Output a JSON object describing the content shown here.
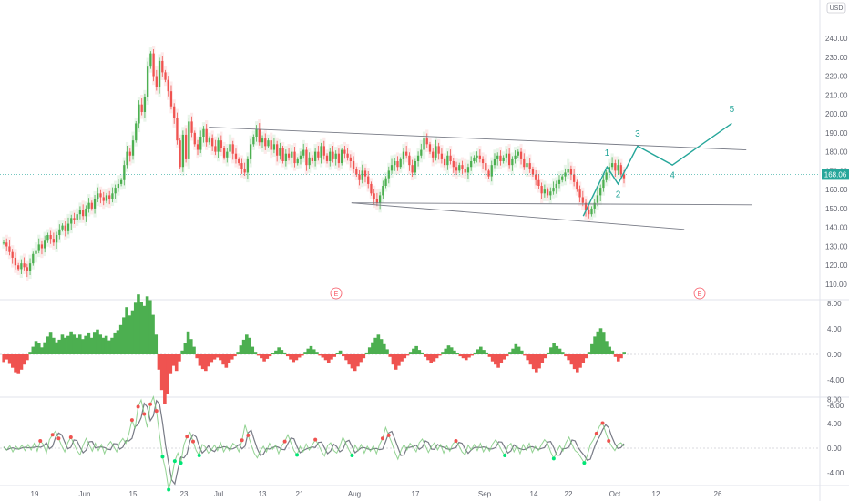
{
  "chart_data": {
    "type": "candlestick",
    "currency": "USD",
    "price_label": "168.06",
    "price_axis": {
      "min": 110,
      "max": 240,
      "ticks": [
        "240.00",
        "230.00",
        "220.00",
        "210.00",
        "200.00",
        "190.00",
        "180.00",
        "170.00",
        "160.00",
        "150.00",
        "140.00",
        "130.00",
        "120.00",
        "110.00"
      ]
    },
    "time_axis": {
      "ticks": [
        "19",
        "Jun",
        "15",
        "23",
        "Jul",
        "13",
        "21",
        "Aug",
        "17",
        "Sep",
        "14",
        "22",
        "Oct",
        "12",
        "26"
      ]
    },
    "osc1_axis": {
      "ticks": [
        "8.00",
        "4.00",
        "0.00",
        "-4.00",
        "-8.00"
      ]
    },
    "osc2_axis": {
      "ticks": [
        "8.00",
        "4.00",
        "0.00",
        "-4.00"
      ]
    },
    "earnings_marker": "E",
    "closes": [
      132,
      130,
      127,
      124,
      120,
      118,
      121,
      119,
      117,
      121,
      126,
      128,
      131,
      129,
      133,
      136,
      134,
      132,
      136,
      139,
      141,
      138,
      142,
      145,
      144,
      147,
      149,
      146,
      150,
      153,
      150,
      155,
      158,
      156,
      154,
      157,
      155,
      158,
      161,
      163,
      165,
      173,
      180,
      178,
      186,
      195,
      205,
      201,
      209,
      225,
      232,
      220,
      214,
      228,
      222,
      218,
      212,
      204,
      198,
      186,
      172,
      189,
      176,
      196,
      190,
      184,
      181,
      188,
      192,
      185,
      187,
      183,
      180,
      186,
      182,
      177,
      180,
      184,
      179,
      176,
      174,
      171,
      169,
      176,
      184,
      188,
      192,
      185,
      187,
      183,
      186,
      181,
      184,
      178,
      182,
      175,
      179,
      177,
      180,
      174,
      176,
      178,
      181,
      173,
      177,
      175,
      180,
      177,
      183,
      178,
      175,
      180,
      176,
      179,
      174,
      181,
      179,
      177,
      175,
      171,
      168,
      165,
      170,
      167,
      163,
      158,
      155,
      153,
      157,
      162,
      166,
      170,
      173,
      175,
      172,
      176,
      180,
      178,
      173,
      169,
      175,
      178,
      181,
      187,
      184,
      180,
      177,
      183,
      179,
      176,
      173,
      178,
      175,
      172,
      170,
      173,
      171,
      169,
      172,
      175,
      177,
      178,
      176,
      174,
      170,
      167,
      173,
      176,
      178,
      175,
      177,
      179,
      173,
      176,
      178,
      180,
      176,
      172,
      174,
      171,
      168,
      165,
      162,
      158,
      160,
      157,
      159,
      161,
      163,
      165,
      167,
      169,
      171,
      168,
      164,
      160,
      156,
      153,
      149,
      147,
      150,
      153,
      157,
      161,
      165,
      169,
      172,
      174,
      170,
      173,
      168,
      166
    ],
    "osc1_values": [
      -1.2,
      -0.8,
      -1.5,
      -2.1,
      -2.8,
      -3.1,
      -2.4,
      -1.6,
      -0.9,
      0.4,
      1.2,
      2.1,
      1.8,
      1.1,
      1.9,
      2.8,
      3.4,
      2.6,
      1.9,
      2.3,
      3.1,
      2.6,
      2.9,
      3.6,
      3.1,
      2.6,
      3.1,
      2.4,
      2.9,
      3.3,
      2.6,
      3.4,
      3.9,
      3.1,
      2.6,
      2.9,
      2.2,
      2.6,
      3.3,
      3.8,
      4.6,
      5.8,
      7.4,
      6.1,
      6.9,
      8.1,
      9.4,
      8.2,
      7.6,
      9.1,
      8.5,
      6.2,
      3.1,
      -2.4,
      -5.6,
      -7.8,
      -6.2,
      -3.1,
      -1.8,
      -2.6,
      -1.1,
      0.6,
      1.8,
      3.6,
      2.4,
      1.2,
      -0.6,
      -1.8,
      -2.3,
      -2.6,
      -1.9,
      -1.2,
      -0.8,
      -0.5,
      -0.9,
      -1.6,
      -2.1,
      -1.4,
      -0.8,
      -0.3,
      0.4,
      1.4,
      2.3,
      3.1,
      2.6,
      1.2,
      0.4,
      -0.2,
      -0.6,
      -1.1,
      -0.7,
      -0.3,
      0.2,
      0.6,
      1.1,
      0.7,
      0.3,
      -0.3,
      -0.8,
      -1.2,
      -0.9,
      -0.5,
      -0.2,
      0.4,
      0.9,
      1.3,
      0.8,
      0.4,
      -0.2,
      -0.5,
      -0.9,
      -1.3,
      -0.8,
      -0.4,
      0.2,
      0.6,
      -0.3,
      -0.9,
      -1.6,
      -2.2,
      -2.6,
      -1.9,
      -1.2,
      -0.6,
      0.3,
      1.1,
      1.9,
      2.6,
      3.1,
      2.4,
      1.6,
      0.8,
      -0.4,
      -1.6,
      -2.4,
      -1.8,
      -1.1,
      -0.6,
      -0.2,
      0.4,
      0.9,
      1.3,
      0.7,
      0.3,
      -0.4,
      -0.9,
      -1.4,
      -1.1,
      -0.6,
      -0.2,
      0.4,
      0.9,
      1.4,
      1.1,
      0.6,
      0.2,
      -0.3,
      -0.6,
      -0.9,
      -0.5,
      -0.2,
      0.3,
      0.8,
      1.2,
      0.7,
      0.3,
      -0.4,
      -1.1,
      -1.6,
      -2.1,
      -1.4,
      -0.8,
      -0.3,
      0.4,
      0.9,
      1.6,
      1.2,
      0.6,
      -0.2,
      -0.9,
      -1.6,
      -2.3,
      -2.8,
      -2.2,
      -1.4,
      -0.6,
      0.3,
      1.1,
      1.8,
      1.3,
      0.9,
      0.4,
      -0.3,
      -0.9,
      -1.6,
      -2.3,
      -2.8,
      -2.1,
      -1.4,
      -0.6,
      0.4,
      1.6,
      2.8,
      3.6,
      4.1,
      3.4,
      2.1,
      1.2,
      0.6,
      -0.4,
      -1.1,
      -0.6,
      0.4
    ],
    "osc2_values": [
      0.2,
      -0.3,
      0.4,
      -0.6,
      0.3,
      -0.2,
      0.5,
      -0.4,
      0.6,
      -0.3,
      0.8,
      -0.5,
      1.2,
      0.6,
      -0.8,
      1.4,
      2.2,
      2.8,
      1.6,
      0.4,
      -0.6,
      0.9,
      1.8,
      0.7,
      -0.4,
      -1.1,
      0.5,
      1.6,
      0.6,
      -0.5,
      0.8,
      -0.4,
      0.6,
      -0.9,
      0.4,
      1.1,
      0.3,
      -0.6,
      0.9,
      1.6,
      0.8,
      2.4,
      4.6,
      3.2,
      6.8,
      7.9,
      5.6,
      3.4,
      7.2,
      8.4,
      6.1,
      2.2,
      -1.4,
      -3.6,
      -6.8,
      -4.9,
      -2.1,
      -0.8,
      -2.4,
      0.6,
      1.9,
      2.6,
      1.1,
      -0.4,
      -1.2,
      0.6,
      0.2,
      -0.8,
      -0.3,
      0.5,
      -0.4,
      0.9,
      -0.6,
      0.3,
      -0.5,
      0.8,
      0.4,
      -0.6,
      1.3,
      3.8,
      2.1,
      0.6,
      -0.8,
      -1.6,
      -0.4,
      0.3,
      -0.6,
      0.8,
      -0.2,
      0.5,
      -0.9,
      0.4,
      1.1,
      2.2,
      0.9,
      -0.4,
      -1.1,
      0.3,
      -0.6,
      0.7,
      -0.3,
      0.5,
      1.4,
      0.6,
      -0.5,
      -1.3,
      0.4,
      0.9,
      -0.4,
      -0.8,
      0.3,
      1.8,
      0.8,
      -0.3,
      -1.2,
      0.5,
      -0.4,
      0.6,
      -0.8,
      0.3,
      -0.5,
      0.4,
      -0.9,
      0.6,
      1.6,
      3.4,
      2.1,
      0.9,
      -0.6,
      -1.8,
      -0.4,
      0.6,
      -0.3,
      0.8,
      0.2,
      -0.6,
      0.9,
      1.5,
      0.4,
      -0.7,
      0.3,
      0.9,
      -0.3,
      0.6,
      -0.8,
      0.4,
      -0.5,
      0.7,
      1.2,
      0.4,
      -0.6,
      -1.1,
      0.5,
      -0.3,
      0.6,
      -0.4,
      0.8,
      -0.6,
      0.3,
      -0.5,
      0.7,
      1.4,
      0.6,
      -0.4,
      -1.2,
      0.3,
      0.8,
      -0.6,
      0.4,
      -0.9,
      0.6,
      -0.3,
      0.8,
      -0.7,
      0.3,
      -0.4,
      0.6,
      1.4,
      0.8,
      -0.6,
      -1.7,
      -0.6,
      0.4,
      -0.5,
      0.9,
      1.8,
      0.6,
      -0.4,
      -0.8,
      -1.6,
      -2.4,
      -1.2,
      0.6,
      1.4,
      2.4,
      3.6,
      4.1,
      2.6,
      1.2,
      0.3,
      -0.4,
      0.6,
      0.9,
      0.3
    ],
    "trendlines": [
      {
        "from": [
          0.246,
          193
        ],
        "to": [
          0.879,
          181
        ]
      },
      {
        "from": [
          0.414,
          153
        ],
        "to": [
          0.886,
          152
        ]
      },
      {
        "from": [
          0.414,
          153
        ],
        "to": [
          0.806,
          139
        ]
      }
    ],
    "wave_path": [
      [
        0.687,
        146
      ],
      [
        0.715,
        172
      ],
      [
        0.728,
        163
      ],
      [
        0.751,
        183
      ],
      [
        0.792,
        173
      ],
      [
        0.862,
        195
      ]
    ],
    "wave_labels": [
      {
        "text": "1",
        "at": [
          0.715,
          178
        ]
      },
      {
        "text": "2",
        "at": [
          0.728,
          156
        ]
      },
      {
        "text": "3",
        "at": [
          0.751,
          188
        ]
      },
      {
        "text": "4",
        "at": [
          0.792,
          166
        ]
      },
      {
        "text": "5",
        "at": [
          0.862,
          201
        ]
      }
    ],
    "colors": {
      "up": "#4caf50",
      "down": "#ef5350",
      "wave": "#26a69a",
      "trend": "#787b86",
      "price_tag": "#26a69a",
      "earn": "#f7525f"
    }
  }
}
